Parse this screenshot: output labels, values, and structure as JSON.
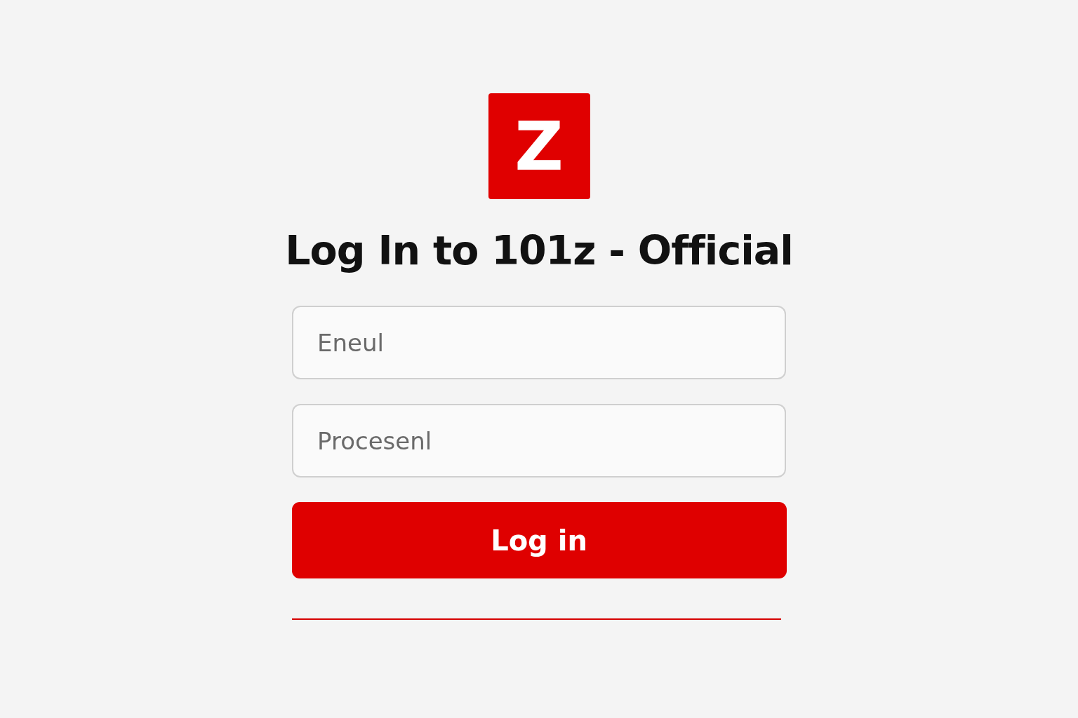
{
  "logo": {
    "letter": "Z"
  },
  "title": "Log In to 101z - Official",
  "fields": [
    {
      "placeholder": "Eneul"
    },
    {
      "placeholder": "Procesenl"
    }
  ],
  "login_button": {
    "label": "Log in"
  }
}
